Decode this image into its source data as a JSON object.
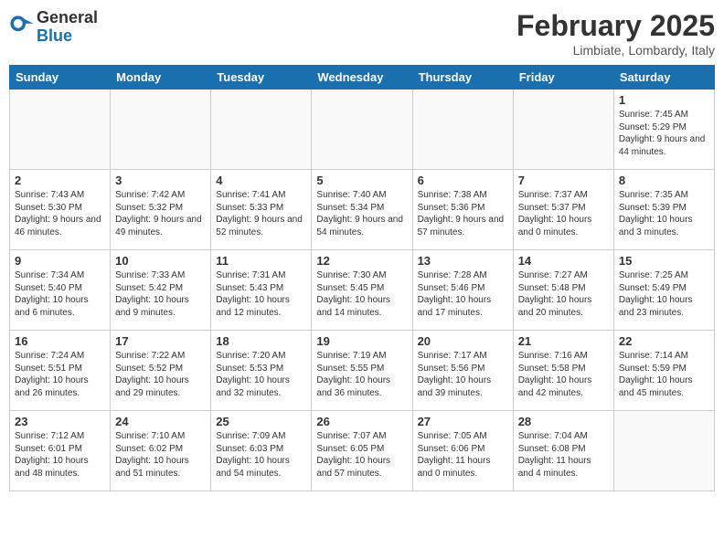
{
  "logo": {
    "general": "General",
    "blue": "Blue"
  },
  "title": "February 2025",
  "location": "Limbiate, Lombardy, Italy",
  "weekdays": [
    "Sunday",
    "Monday",
    "Tuesday",
    "Wednesday",
    "Thursday",
    "Friday",
    "Saturday"
  ],
  "weeks": [
    [
      {
        "day": "",
        "info": ""
      },
      {
        "day": "",
        "info": ""
      },
      {
        "day": "",
        "info": ""
      },
      {
        "day": "",
        "info": ""
      },
      {
        "day": "",
        "info": ""
      },
      {
        "day": "",
        "info": ""
      },
      {
        "day": "1",
        "info": "Sunrise: 7:45 AM\nSunset: 5:29 PM\nDaylight: 9 hours and 44 minutes."
      }
    ],
    [
      {
        "day": "2",
        "info": "Sunrise: 7:43 AM\nSunset: 5:30 PM\nDaylight: 9 hours and 46 minutes."
      },
      {
        "day": "3",
        "info": "Sunrise: 7:42 AM\nSunset: 5:32 PM\nDaylight: 9 hours and 49 minutes."
      },
      {
        "day": "4",
        "info": "Sunrise: 7:41 AM\nSunset: 5:33 PM\nDaylight: 9 hours and 52 minutes."
      },
      {
        "day": "5",
        "info": "Sunrise: 7:40 AM\nSunset: 5:34 PM\nDaylight: 9 hours and 54 minutes."
      },
      {
        "day": "6",
        "info": "Sunrise: 7:38 AM\nSunset: 5:36 PM\nDaylight: 9 hours and 57 minutes."
      },
      {
        "day": "7",
        "info": "Sunrise: 7:37 AM\nSunset: 5:37 PM\nDaylight: 10 hours and 0 minutes."
      },
      {
        "day": "8",
        "info": "Sunrise: 7:35 AM\nSunset: 5:39 PM\nDaylight: 10 hours and 3 minutes."
      }
    ],
    [
      {
        "day": "9",
        "info": "Sunrise: 7:34 AM\nSunset: 5:40 PM\nDaylight: 10 hours and 6 minutes."
      },
      {
        "day": "10",
        "info": "Sunrise: 7:33 AM\nSunset: 5:42 PM\nDaylight: 10 hours and 9 minutes."
      },
      {
        "day": "11",
        "info": "Sunrise: 7:31 AM\nSunset: 5:43 PM\nDaylight: 10 hours and 12 minutes."
      },
      {
        "day": "12",
        "info": "Sunrise: 7:30 AM\nSunset: 5:45 PM\nDaylight: 10 hours and 14 minutes."
      },
      {
        "day": "13",
        "info": "Sunrise: 7:28 AM\nSunset: 5:46 PM\nDaylight: 10 hours and 17 minutes."
      },
      {
        "day": "14",
        "info": "Sunrise: 7:27 AM\nSunset: 5:48 PM\nDaylight: 10 hours and 20 minutes."
      },
      {
        "day": "15",
        "info": "Sunrise: 7:25 AM\nSunset: 5:49 PM\nDaylight: 10 hours and 23 minutes."
      }
    ],
    [
      {
        "day": "16",
        "info": "Sunrise: 7:24 AM\nSunset: 5:51 PM\nDaylight: 10 hours and 26 minutes."
      },
      {
        "day": "17",
        "info": "Sunrise: 7:22 AM\nSunset: 5:52 PM\nDaylight: 10 hours and 29 minutes."
      },
      {
        "day": "18",
        "info": "Sunrise: 7:20 AM\nSunset: 5:53 PM\nDaylight: 10 hours and 32 minutes."
      },
      {
        "day": "19",
        "info": "Sunrise: 7:19 AM\nSunset: 5:55 PM\nDaylight: 10 hours and 36 minutes."
      },
      {
        "day": "20",
        "info": "Sunrise: 7:17 AM\nSunset: 5:56 PM\nDaylight: 10 hours and 39 minutes."
      },
      {
        "day": "21",
        "info": "Sunrise: 7:16 AM\nSunset: 5:58 PM\nDaylight: 10 hours and 42 minutes."
      },
      {
        "day": "22",
        "info": "Sunrise: 7:14 AM\nSunset: 5:59 PM\nDaylight: 10 hours and 45 minutes."
      }
    ],
    [
      {
        "day": "23",
        "info": "Sunrise: 7:12 AM\nSunset: 6:01 PM\nDaylight: 10 hours and 48 minutes."
      },
      {
        "day": "24",
        "info": "Sunrise: 7:10 AM\nSunset: 6:02 PM\nDaylight: 10 hours and 51 minutes."
      },
      {
        "day": "25",
        "info": "Sunrise: 7:09 AM\nSunset: 6:03 PM\nDaylight: 10 hours and 54 minutes."
      },
      {
        "day": "26",
        "info": "Sunrise: 7:07 AM\nSunset: 6:05 PM\nDaylight: 10 hours and 57 minutes."
      },
      {
        "day": "27",
        "info": "Sunrise: 7:05 AM\nSunset: 6:06 PM\nDaylight: 11 hours and 0 minutes."
      },
      {
        "day": "28",
        "info": "Sunrise: 7:04 AM\nSunset: 6:08 PM\nDaylight: 11 hours and 4 minutes."
      },
      {
        "day": "",
        "info": ""
      }
    ]
  ]
}
